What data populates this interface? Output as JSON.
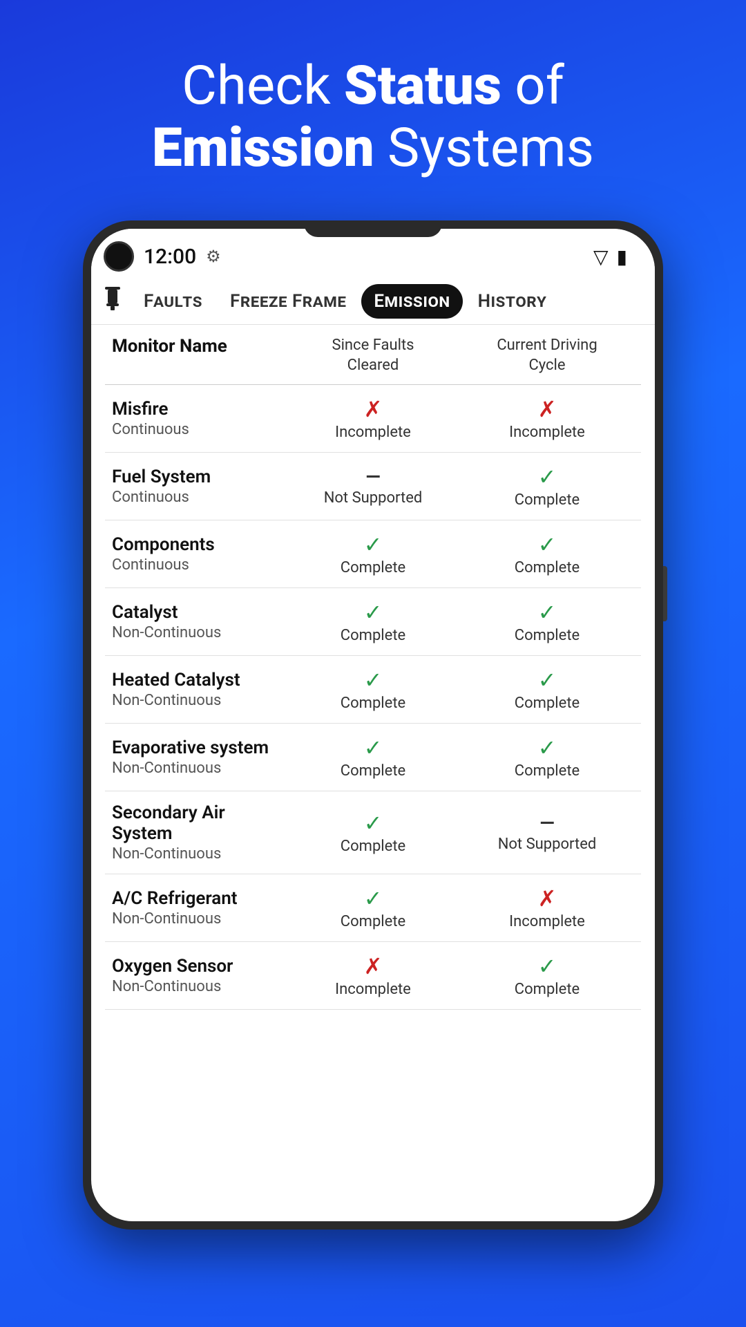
{
  "hero": {
    "line1": "Check ",
    "bold1": "Status",
    "line2": " of",
    "line3": "",
    "bold2": "Emission",
    "line4": " Systems"
  },
  "status_bar": {
    "time": "12:00",
    "wifi_icon": "⊕",
    "battery_icon": "▮"
  },
  "tabs": [
    {
      "id": "faults",
      "label": "Faults",
      "active": false
    },
    {
      "id": "freeze_frame",
      "label": "Freeze Frame",
      "active": false
    },
    {
      "id": "emission",
      "label": "Emission",
      "active": true
    },
    {
      "id": "history",
      "label": "History",
      "active": false
    }
  ],
  "table": {
    "headers": {
      "name": "Monitor Name",
      "col1": "Since Faults\nCleared",
      "col2": "Current Driving\nCycle"
    },
    "rows": [
      {
        "name": "Misfire",
        "subname": "Continuous",
        "col1_status": "incomplete",
        "col1_icon": "✗",
        "col1_label": "Incomplete",
        "col2_status": "incomplete",
        "col2_icon": "✗",
        "col2_label": "Incomplete"
      },
      {
        "name": "Fuel System",
        "subname": "Continuous",
        "col1_status": "not-supported",
        "col1_icon": "—",
        "col1_label": "Not Supported",
        "col2_status": "complete",
        "col2_icon": "✓",
        "col2_label": "Complete"
      },
      {
        "name": "Components",
        "subname": "Continuous",
        "col1_status": "complete",
        "col1_icon": "✓",
        "col1_label": "Complete",
        "col2_status": "complete",
        "col2_icon": "✓",
        "col2_label": "Complete"
      },
      {
        "name": "Catalyst",
        "subname": "Non-Continuous",
        "col1_status": "complete",
        "col1_icon": "✓",
        "col1_label": "Complete",
        "col2_status": "complete",
        "col2_icon": "✓",
        "col2_label": "Complete"
      },
      {
        "name": "Heated Catalyst",
        "subname": "Non-Continuous",
        "col1_status": "complete",
        "col1_icon": "✓",
        "col1_label": "Complete",
        "col2_status": "complete",
        "col2_icon": "✓",
        "col2_label": "Complete"
      },
      {
        "name": "Evaporative system",
        "subname": "Non-Continuous",
        "col1_status": "complete",
        "col1_icon": "✓",
        "col1_label": "Complete",
        "col2_status": "complete",
        "col2_icon": "✓",
        "col2_label": "Complete"
      },
      {
        "name": "Secondary Air System",
        "subname": "Non-Continuous",
        "col1_status": "complete",
        "col1_icon": "✓",
        "col1_label": "Complete",
        "col2_status": "not-supported",
        "col2_icon": "—",
        "col2_label": "Not Supported"
      },
      {
        "name": "A/C Refrigerant",
        "subname": "Non-Continuous",
        "col1_status": "complete",
        "col1_icon": "✓",
        "col1_label": "Complete",
        "col2_status": "incomplete",
        "col2_icon": "✗",
        "col2_label": "Incomplete"
      },
      {
        "name": "Oxygen Sensor",
        "subname": "Non-Continuous",
        "col1_status": "incomplete",
        "col1_icon": "✗",
        "col1_label": "Incomplete",
        "col2_status": "complete",
        "col2_icon": "✓",
        "col2_label": "Complete"
      }
    ]
  }
}
